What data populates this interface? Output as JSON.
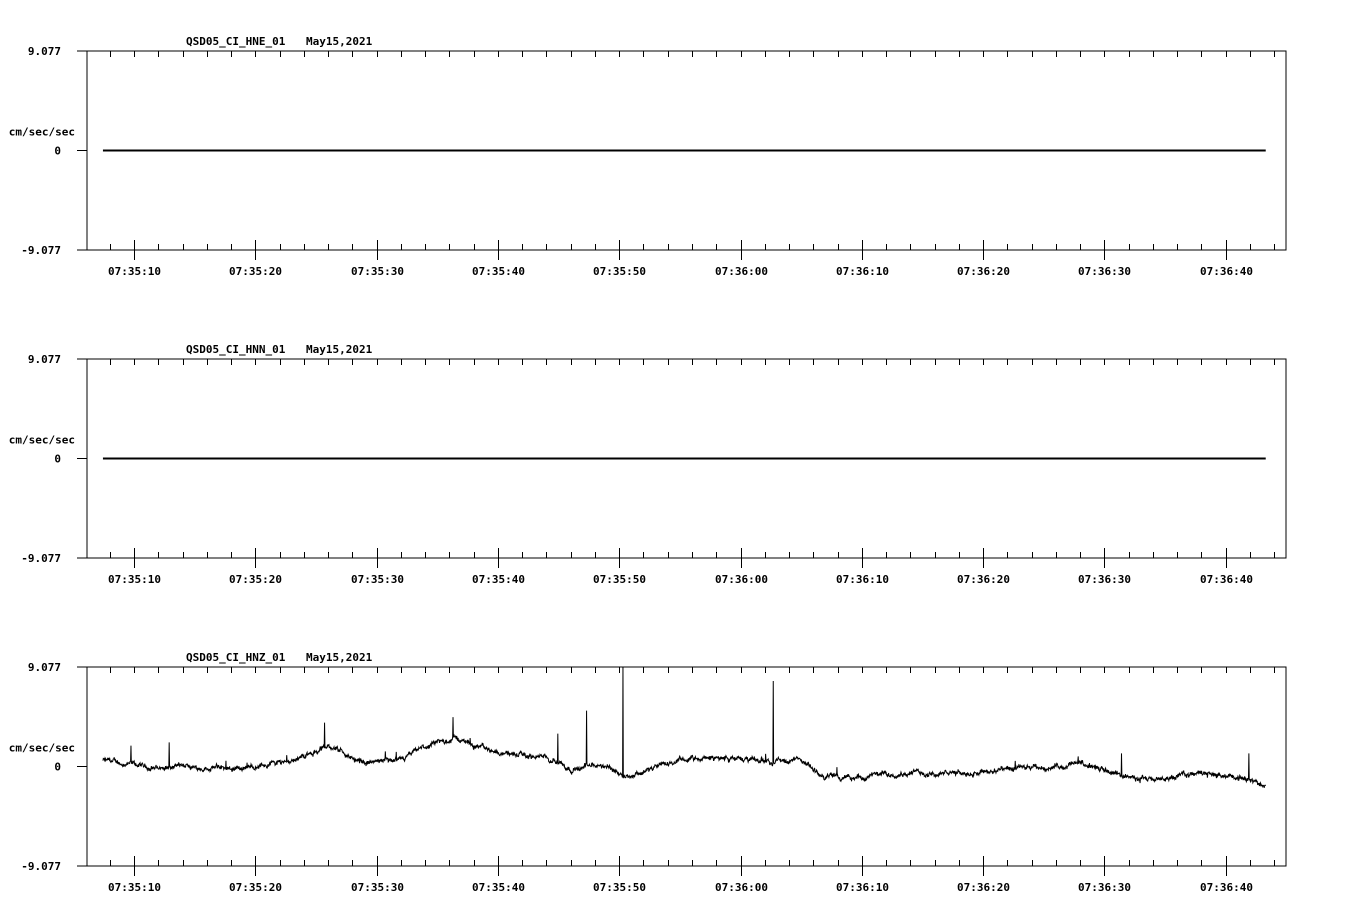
{
  "chart_data": [
    {
      "type": "line",
      "title": "QSD05_CI_HNE_01",
      "date": "May15,2021",
      "ylabel": "cm/sec/sec",
      "ylim": [
        -9.077,
        9.077
      ],
      "ytick_labels": [
        "9.077",
        "0",
        "-9.077"
      ],
      "xlim_seconds_after_07_35_00": [
        6.2,
        105.0
      ],
      "xtick_labels": [
        "07:35:10",
        "07:35:20",
        "07:35:30",
        "07:35:40",
        "07:35:50",
        "07:36:00",
        "07:36:10",
        "07:36:20",
        "07:36:30",
        "07:36:40"
      ],
      "minor_tick_interval_s": 2,
      "trace": {
        "t": [
          7.44,
          103.3
        ],
        "v": [
          0,
          0
        ]
      },
      "spikes": {
        "t": [],
        "v": []
      },
      "noise": 0
    },
    {
      "type": "line",
      "title": "QSD05_CI_HNN_01",
      "date": "May15,2021",
      "ylabel": "cm/sec/sec",
      "ylim": [
        -9.077,
        9.077
      ],
      "ytick_labels": [
        "9.077",
        "0",
        "-9.077"
      ],
      "xlim_seconds_after_07_35_00": [
        6.2,
        105.0
      ],
      "xtick_labels": [
        "07:35:10",
        "07:35:20",
        "07:35:30",
        "07:35:40",
        "07:35:50",
        "07:36:00",
        "07:36:10",
        "07:36:20",
        "07:36:30",
        "07:36:40"
      ],
      "minor_tick_interval_s": 2,
      "trace": {
        "t": [
          7.44,
          103.3
        ],
        "v": [
          0,
          0
        ]
      },
      "spikes": {
        "t": [],
        "v": []
      },
      "noise": 0
    },
    {
      "type": "line",
      "title": "QSD05_CI_HNZ_01",
      "date": "May15,2021",
      "ylabel": "cm/sec/sec",
      "ylim": [
        -9.077,
        9.077
      ],
      "ytick_labels": [
        "9.077",
        "0",
        "-9.077"
      ],
      "xlim_seconds_after_07_35_00": [
        6.2,
        105.0
      ],
      "xtick_labels": [
        "07:35:10",
        "07:35:20",
        "07:35:30",
        "07:35:40",
        "07:35:50",
        "07:36:00",
        "07:36:10",
        "07:36:20",
        "07:36:30",
        "07:36:40"
      ],
      "minor_tick_interval_s": 2,
      "trace": {
        "t": [
          7.44,
          11.3,
          19.6,
          23.7,
          26.2,
          28.6,
          31.9,
          33.6,
          36.5,
          39.3,
          41.8,
          44.7,
          45.9,
          48.4,
          50.9,
          55.0,
          58.3,
          61.6,
          64.9,
          66.6,
          69.0,
          73.2,
          77.3,
          81.4,
          85.5,
          88.0,
          90.5,
          93.8,
          97.9,
          101.2,
          103.3
        ],
        "v": [
          0.55,
          -0.1,
          -0.1,
          0.8,
          1.9,
          0.4,
          0.4,
          1.6,
          2.6,
          1.5,
          1.0,
          0.7,
          -0.2,
          0.1,
          -0.8,
          0.55,
          0.8,
          0.55,
          0.55,
          -0.8,
          -1.1,
          -0.55,
          -0.65,
          -0.35,
          -0.1,
          0.3,
          -0.55,
          -1.3,
          -0.55,
          -1.1,
          -1.7
        ]
      },
      "spikes": {
        "t": [
          9.75,
          12.9,
          25.7,
          36.3,
          44.95,
          47.3,
          50.3,
          62.7,
          91.4,
          101.9
        ],
        "v": [
          1.9,
          2.2,
          4.0,
          4.5,
          3.0,
          5.1,
          9.077,
          7.8,
          1.2,
          1.2
        ]
      },
      "noise": 0.35
    }
  ]
}
